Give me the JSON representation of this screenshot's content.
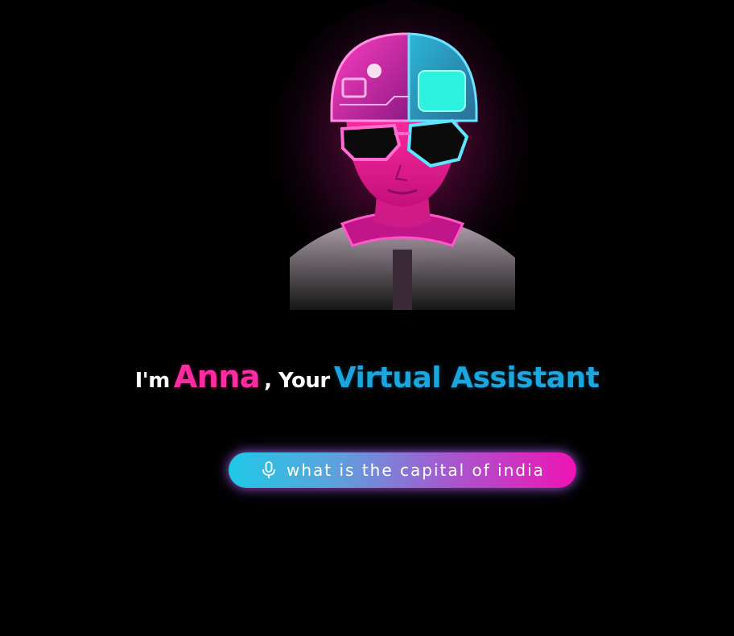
{
  "hero": {
    "greeting_prefix": "I'm",
    "assistant_name": "Anna",
    "greeting_middle": ", Your",
    "assistant_role": "Virtual Assistant"
  },
  "voice_input": {
    "icon": "microphone-icon",
    "transcript": "what is the capital of india"
  },
  "colors": {
    "background": "#000000",
    "name_accent": "#ff2ba0",
    "role_accent": "#1aa6de",
    "pill_gradient_start": "#1fc9e6",
    "pill_gradient_end": "#f013b4"
  }
}
